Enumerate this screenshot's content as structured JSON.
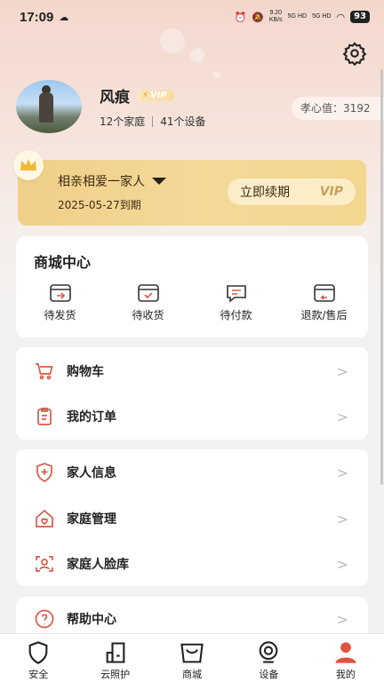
{
  "status": {
    "time": "17:09",
    "speed": "9.20\nKB/s",
    "sig1": "5G HD",
    "sig2": "5G HD",
    "battery": "93"
  },
  "profile": {
    "name": "风痕",
    "vip_badge": "VIP",
    "families": "12个家庭",
    "devices": "41个设备",
    "xiaoxin": "孝心值：3192"
  },
  "vip": {
    "family_name": "相亲相爱一家人",
    "expire": "2025-05-27到期",
    "renew": "立即续期",
    "vip_text": "VIP"
  },
  "shop": {
    "title": "商城中心",
    "items": [
      {
        "label": "待发货",
        "icon": "pending-ship-icon"
      },
      {
        "label": "待收货",
        "icon": "pending-receive-icon"
      },
      {
        "label": "待付款",
        "icon": "pending-pay-icon"
      },
      {
        "label": "退款/售后",
        "icon": "refund-icon"
      }
    ]
  },
  "menu": {
    "cart": "购物车",
    "orders": "我的订单",
    "family_info": "家人信息",
    "family_manage": "家庭管理",
    "face_lib": "家庭人脸库",
    "help": "帮助中心"
  },
  "tabs": [
    {
      "label": "安全",
      "icon": "shield-icon"
    },
    {
      "label": "云照护",
      "icon": "cloud-care-icon"
    },
    {
      "label": "商城",
      "icon": "shopping-bag-icon"
    },
    {
      "label": "设备",
      "icon": "camera-device-icon"
    },
    {
      "label": "我的",
      "icon": "person-icon"
    }
  ],
  "colors": {
    "accent": "#e0533f",
    "icon_red": "#d95a4a",
    "vip_gold": "#f0cf87"
  }
}
